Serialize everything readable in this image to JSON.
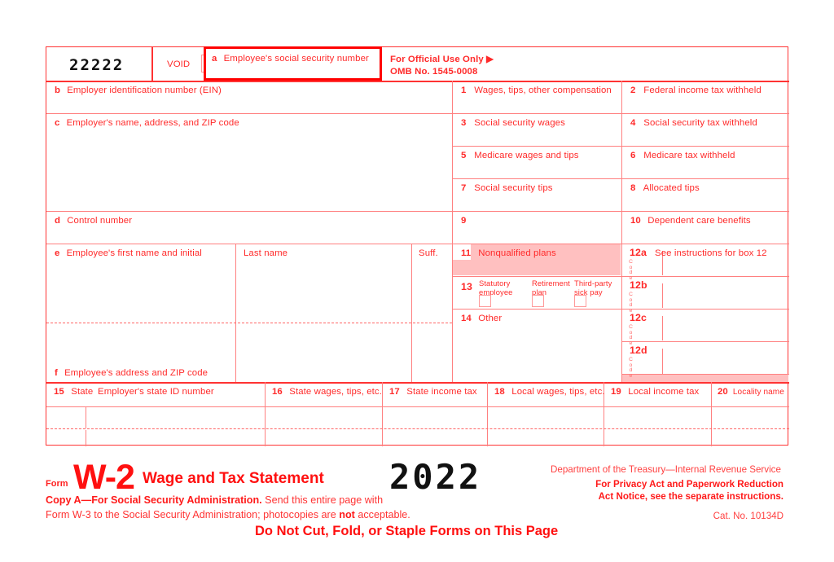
{
  "document": {
    "type": "IRS Form W-2",
    "title": "Wage and Tax Statement",
    "form_label": "Form",
    "form_name": "W-2",
    "year": "2022",
    "catalog_number": "Cat. No. 10134D",
    "omb": "OMB No. 1545-0008",
    "official_use": "For Official Use Only ▶",
    "control_digits": "22222",
    "void_label": "VOID",
    "colors": {
      "red": "#ff3333",
      "bright_red": "#ff1010",
      "rule": "#ff8080",
      "shade": "#ffc0c0",
      "black": "#111111"
    }
  },
  "boxes": {
    "a": {
      "letter": "a",
      "label": "Employee's social security number"
    },
    "b": {
      "letter": "b",
      "label": "Employer identification number (EIN)"
    },
    "c": {
      "letter": "c",
      "label": "Employer's name, address, and ZIP code"
    },
    "d": {
      "letter": "d",
      "label": "Control number"
    },
    "e": {
      "letter": "e",
      "label": "Employee's first name and initial"
    },
    "e_last": {
      "label": "Last name"
    },
    "e_suffix": {
      "label": "Suff."
    },
    "f": {
      "letter": "f",
      "label": "Employee's address and ZIP code"
    },
    "b1": {
      "num": "1",
      "label": "Wages, tips, other compensation"
    },
    "b2": {
      "num": "2",
      "label": "Federal income tax withheld"
    },
    "b3": {
      "num": "3",
      "label": "Social security wages"
    },
    "b4": {
      "num": "4",
      "label": "Social security tax withheld"
    },
    "b5": {
      "num": "5",
      "label": "Medicare wages and tips"
    },
    "b6": {
      "num": "6",
      "label": "Medicare tax withheld"
    },
    "b7": {
      "num": "7",
      "label": "Social security tips"
    },
    "b8": {
      "num": "8",
      "label": "Allocated tips"
    },
    "b9": {
      "num": "9",
      "label": ""
    },
    "b10": {
      "num": "10",
      "label": "Dependent care benefits"
    },
    "b11": {
      "num": "11",
      "label": "Nonqualified plans"
    },
    "b12a": {
      "num": "12a",
      "label": "See instructions for box 12",
      "code": "Code"
    },
    "b12b": {
      "num": "12b",
      "label": "",
      "code": "Code"
    },
    "b12c": {
      "num": "12c",
      "label": "",
      "code": "Code"
    },
    "b12d": {
      "num": "12d",
      "label": "",
      "code": "Code"
    },
    "b13": {
      "num": "13",
      "checkboxes": [
        {
          "line1": "Statutory",
          "line2": "employee",
          "checked": false
        },
        {
          "line1": "Retirement",
          "line2": "plan",
          "checked": false
        },
        {
          "line1": "Third-party",
          "line2": "sick pay",
          "checked": false
        }
      ]
    },
    "b14": {
      "num": "14",
      "label": "Other"
    },
    "b15": {
      "num": "15",
      "label": "State",
      "secondary": "Employer's state ID number"
    },
    "b16": {
      "num": "16",
      "label": "State wages, tips, etc."
    },
    "b17": {
      "num": "17",
      "label": "State income tax"
    },
    "b18": {
      "num": "18",
      "label": "Local wages, tips, etc."
    },
    "b19": {
      "num": "19",
      "label": "Local income tax"
    },
    "b20": {
      "num": "20",
      "label": "Locality name"
    }
  },
  "footer": {
    "copy_a_bold": "Copy A—For Social Security Administration.",
    "copy_a_rest": " Send this entire page with",
    "line2_pre": "Form W-3 to the Social Security Administration; photocopies are ",
    "line2_bold": "not",
    "line2_post": " acceptable.",
    "do_not_cut": "Do Not Cut, Fold, or Staple Forms on This Page",
    "department": "Department of the Treasury—Internal Revenue Service",
    "privacy_line1": "For Privacy Act and Paperwork Reduction",
    "privacy_line2": "Act Notice, see the separate instructions."
  }
}
